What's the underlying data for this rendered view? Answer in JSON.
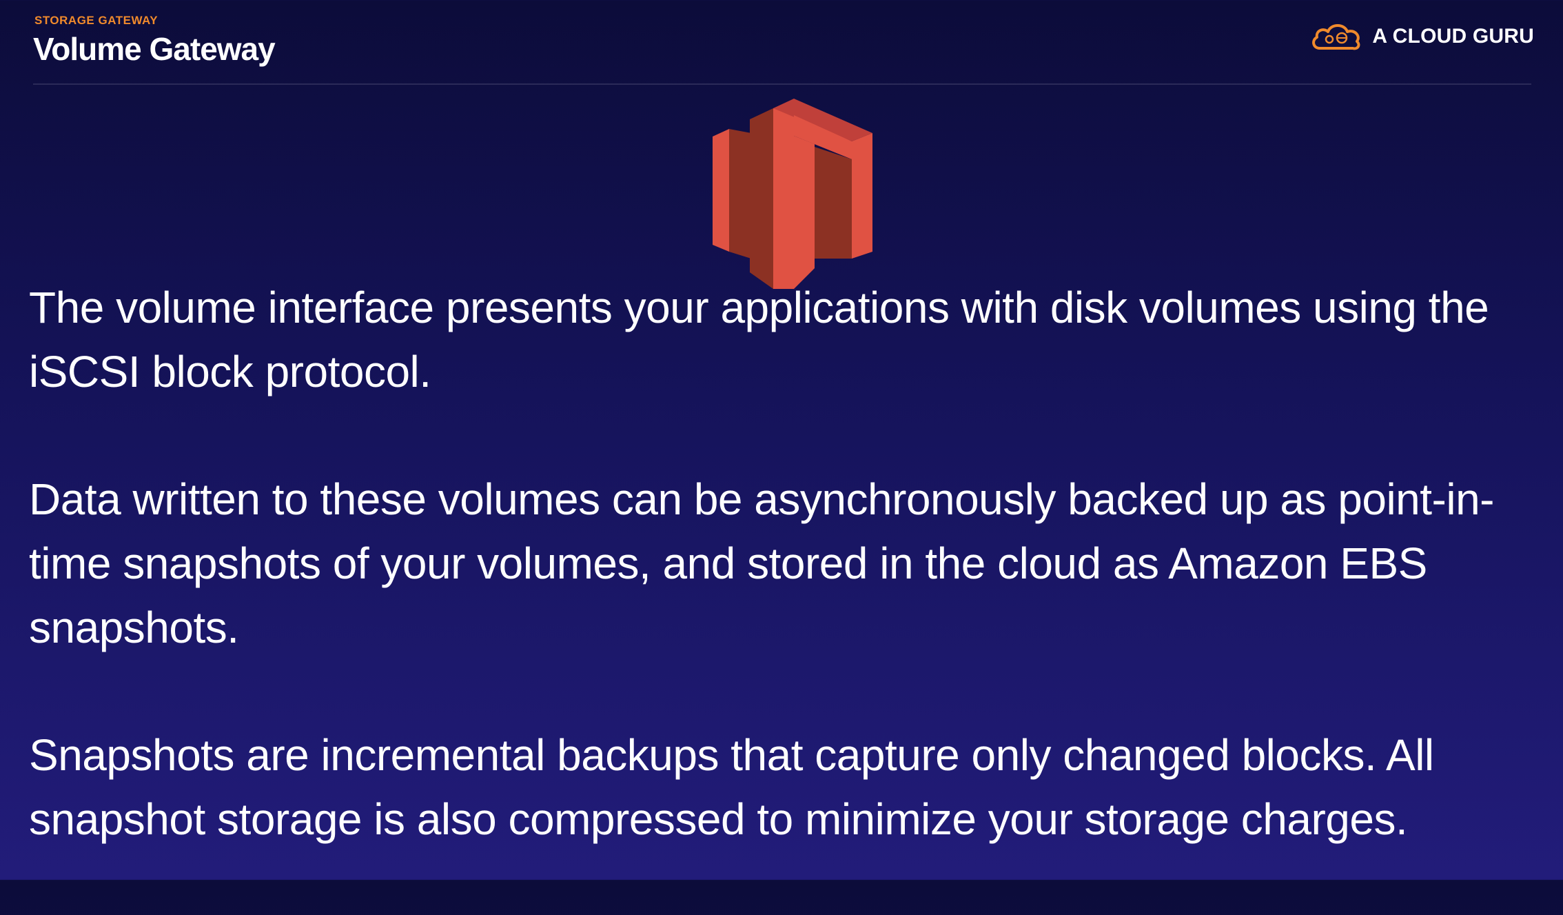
{
  "header": {
    "kicker": "STORAGE GATEWAY",
    "title": "Volume Gateway",
    "brand_logo": "cloud-guru-logo-icon",
    "brand_name": "A CLOUD GURU"
  },
  "main": {
    "service_icon": "storage-gateway-icon",
    "paragraphs": [
      "The volume interface presents your applications with disk volumes using the iSCSI block protocol.",
      "Data written to these volumes can be asynchronously backed up as point-in-time snapshots of your volumes, and stored in the cloud as Amazon EBS snapshots.",
      "Snapshots are incremental backups that capture only changed blocks. All snapshot storage is also compressed to minimize your storage charges."
    ]
  },
  "colors": {
    "kicker": "#f08a2c",
    "brand_logo": "#f08a2c",
    "icon_light": "#e05243",
    "icon_dark": "#8c3123"
  }
}
